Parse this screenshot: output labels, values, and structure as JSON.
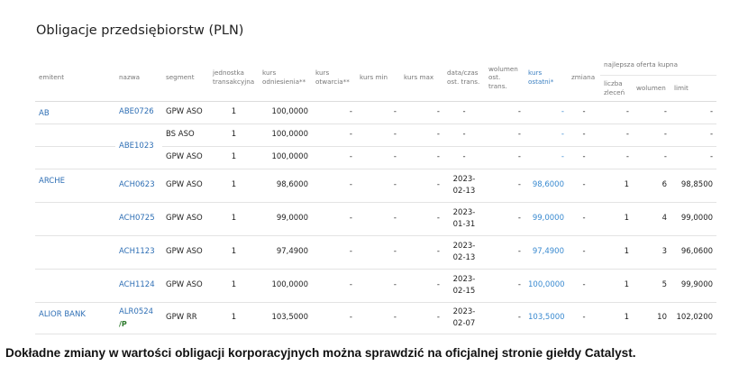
{
  "page_title": "Obligacje przedsiębiorstw (PLN)",
  "header": {
    "emitent": "emitent",
    "nazwa": "nazwa",
    "segment": "segment",
    "jednostka": "jednostka transakcyjna",
    "kurs_odniesienia": "kurs odniesienia**",
    "kurs_otwarcia": "kurs otwarcia**",
    "kurs_min": "kurs min",
    "kurs_max": "kurs max",
    "data_czas": "data/czas ost. trans.",
    "wolumen_ost": "wolumen ost. trans.",
    "kurs_ostatni": "kurs ostatni*",
    "zmiana": "zmiana",
    "najlepsza": "najlepsza oferta kupna",
    "liczba_zlecen": "liczba zleceń",
    "wolumen": "wolumen",
    "limit": "limit"
  },
  "rows": [
    {
      "emitent": "AB",
      "nazwa": "ABE0726",
      "tag": "",
      "segment": "GPW ASO",
      "jednostka": "1",
      "kurs_odn": "100,0000",
      "kurs_otw": "-",
      "kurs_min": "-",
      "kurs_max": "-",
      "data1": "-",
      "data2": "",
      "wolumen_ost": "-",
      "kurs_ost": "-",
      "zmiana": "-",
      "liczba": "-",
      "wolumen": "-",
      "limit": "-"
    },
    {
      "emitent": "",
      "nazwa": "ABE1023",
      "tag": "",
      "segment": "BS ASO",
      "jednostka": "1",
      "kurs_odn": "100,0000",
      "kurs_otw": "-",
      "kurs_min": "-",
      "kurs_max": "-",
      "data1": "-",
      "data2": "",
      "wolumen_ost": "-",
      "kurs_ost": "-",
      "zmiana": "-",
      "liczba": "-",
      "wolumen": "-",
      "limit": "-"
    },
    {
      "emitent": "",
      "nazwa": "",
      "tag": "",
      "segment": "GPW ASO",
      "jednostka": "1",
      "kurs_odn": "100,0000",
      "kurs_otw": "-",
      "kurs_min": "-",
      "kurs_max": "-",
      "data1": "-",
      "data2": "",
      "wolumen_ost": "-",
      "kurs_ost": "-",
      "zmiana": "-",
      "liczba": "-",
      "wolumen": "-",
      "limit": "-"
    },
    {
      "emitent": "ARCHE",
      "nazwa": "ACH0623",
      "tag": "",
      "segment": "GPW ASO",
      "jednostka": "1",
      "kurs_odn": "98,6000",
      "kurs_otw": "-",
      "kurs_min": "-",
      "kurs_max": "-",
      "data1": "2023-",
      "data2": "02-13",
      "wolumen_ost": "-",
      "kurs_ost": "98,6000",
      "zmiana": "-",
      "liczba": "1",
      "wolumen": "6",
      "limit": "98,8500"
    },
    {
      "emitent": "",
      "nazwa": "ACH0725",
      "tag": "",
      "segment": "GPW ASO",
      "jednostka": "1",
      "kurs_odn": "99,0000",
      "kurs_otw": "-",
      "kurs_min": "-",
      "kurs_max": "-",
      "data1": "2023-",
      "data2": "01-31",
      "wolumen_ost": "-",
      "kurs_ost": "99,0000",
      "zmiana": "-",
      "liczba": "1",
      "wolumen": "4",
      "limit": "99,0000"
    },
    {
      "emitent": "",
      "nazwa": "ACH1123",
      "tag": "",
      "segment": "GPW ASO",
      "jednostka": "1",
      "kurs_odn": "97,4900",
      "kurs_otw": "-",
      "kurs_min": "-",
      "kurs_max": "-",
      "data1": "2023-",
      "data2": "02-13",
      "wolumen_ost": "-",
      "kurs_ost": "97,4900",
      "zmiana": "-",
      "liczba": "1",
      "wolumen": "3",
      "limit": "96,0600"
    },
    {
      "emitent": "",
      "nazwa": "ACH1124",
      "tag": "",
      "segment": "GPW ASO",
      "jednostka": "1",
      "kurs_odn": "100,0000",
      "kurs_otw": "-",
      "kurs_min": "-",
      "kurs_max": "-",
      "data1": "2023-",
      "data2": "02-15",
      "wolumen_ost": "-",
      "kurs_ost": "100,0000",
      "zmiana": "-",
      "liczba": "1",
      "wolumen": "5",
      "limit": "99,9000"
    },
    {
      "emitent": "ALIOR BANK",
      "nazwa": "ALR0524",
      "tag": "/P",
      "segment": "GPW RR",
      "jednostka": "1",
      "kurs_odn": "103,5000",
      "kurs_otw": "-",
      "kurs_min": "-",
      "kurs_max": "-",
      "data1": "2023-",
      "data2": "02-07",
      "wolumen_ost": "-",
      "kurs_ost": "103,5000",
      "zmiana": "-",
      "liczba": "1",
      "wolumen": "10",
      "limit": "102,0200"
    }
  ],
  "footer_note": "Dokładne zmiany w wartości obligacji korporacyjnych można sprawdzić na oficjalnej stronie giełdy Catalyst.",
  "colors": {
    "link": "#2f6fb5",
    "last_price": "#3a8ad0",
    "tag": "#2d7a2d"
  }
}
